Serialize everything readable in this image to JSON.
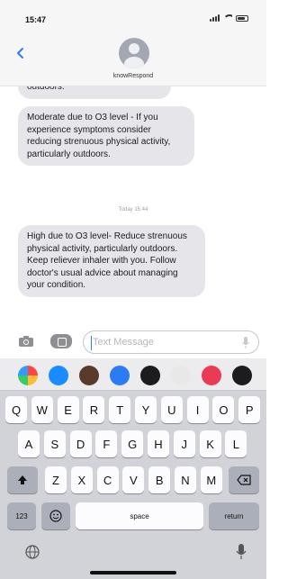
{
  "status_bar": {
    "time": "15:47"
  },
  "header": {
    "contact_name": "knowRespond"
  },
  "messages": {
    "top_partial": "outdoors.",
    "moderate": "Moderate due to O3 level - If you experience symptoms consider reducing strenuous physical activity, particularly outdoors.",
    "timestamp": "Today 15:44",
    "high": "High due to O3 level- Reduce strenuous physical activity, particularly outdoors. Keep reliever inhaler with you. Follow doctor's usual advice about managing your condition."
  },
  "input": {
    "placeholder": "Text Message"
  },
  "keyboard": {
    "row1": [
      "Q",
      "W",
      "E",
      "R",
      "T",
      "Y",
      "U",
      "I",
      "O",
      "P"
    ],
    "row2": [
      "A",
      "S",
      "D",
      "F",
      "G",
      "H",
      "J",
      "K",
      "L"
    ],
    "row3": [
      "Z",
      "X",
      "C",
      "V",
      "B",
      "N",
      "M"
    ],
    "numbers_label": "123",
    "space_label": "space",
    "return_label": "return"
  },
  "app_icons": [
    {
      "name": "photos-app",
      "color": "#ffffff"
    },
    {
      "name": "appstore-app",
      "color": "#1a8cff"
    },
    {
      "name": "memoji-app",
      "color": "#5a3a2a"
    },
    {
      "name": "audio-app",
      "color": "#2b7bf2"
    },
    {
      "name": "activity-app",
      "color": "#1c1c1e"
    },
    {
      "name": "memoji-app-2",
      "color": "#e8e8e8"
    },
    {
      "name": "search-app",
      "color": "#e93b54"
    },
    {
      "name": "music-app",
      "color": "#1c1c1e"
    }
  ],
  "colors": {
    "bubble": "#e5e5ea",
    "accent": "#2f7cf6"
  }
}
